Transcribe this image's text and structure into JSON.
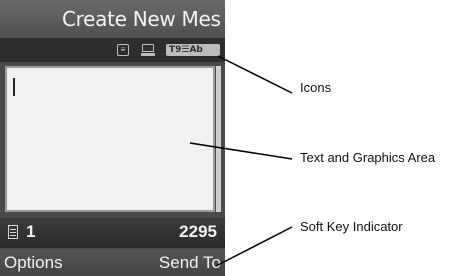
{
  "screen": {
    "title": "Create New Mes",
    "status_icons": [
      "message-icon",
      "memory-icon",
      "t9-mode-icon"
    ],
    "t9_indicator": "T9☰Ab",
    "page_number": "1",
    "char_count": "2295"
  },
  "softkeys": {
    "left": "Options",
    "right": "Send To"
  },
  "callouts": {
    "icons": "Icons",
    "text_area": "Text and Graphics Area",
    "softkey": "Soft Key Indicator"
  }
}
